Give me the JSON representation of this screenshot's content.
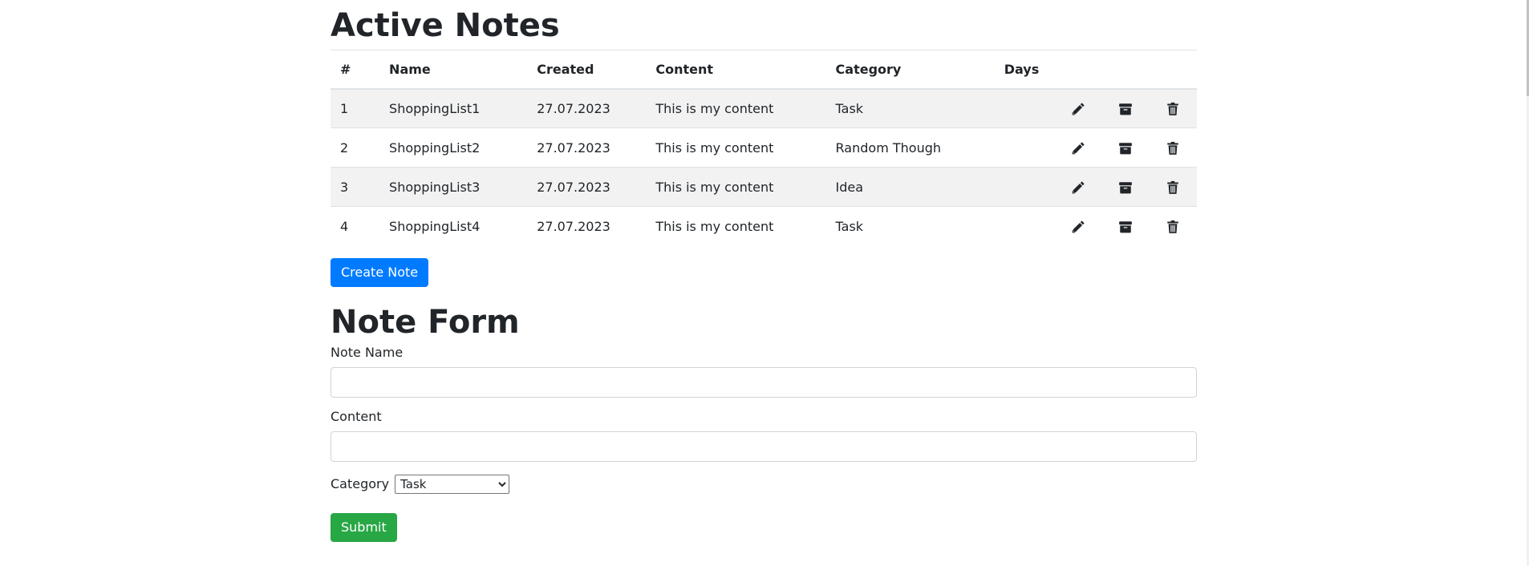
{
  "active_notes": {
    "title": "Active Notes",
    "columns": [
      "#",
      "Name",
      "Created",
      "Content",
      "Category",
      "Days"
    ],
    "rows": [
      {
        "num": "1",
        "name": "ShoppingList1",
        "created": "27.07.2023",
        "content": "This is my content",
        "category": "Task",
        "days": ""
      },
      {
        "num": "2",
        "name": "ShoppingList2",
        "created": "27.07.2023",
        "content": "This is my content",
        "category": "Random Though",
        "days": ""
      },
      {
        "num": "3",
        "name": "ShoppingList3",
        "created": "27.07.2023",
        "content": "This is my content",
        "category": "Idea",
        "days": ""
      },
      {
        "num": "4",
        "name": "ShoppingList4",
        "created": "27.07.2023",
        "content": "This is my content",
        "category": "Task",
        "days": ""
      }
    ],
    "row_actions": [
      "pencil-icon",
      "archive-icon",
      "trash-icon"
    ],
    "create_label": "Create Note"
  },
  "note_form": {
    "title": "Note Form",
    "name_label": "Note Name",
    "name_value": "",
    "content_label": "Content",
    "content_value": "",
    "category_label": "Category",
    "category_selected": "Task",
    "submit_label": "Submit"
  },
  "colors": {
    "primary": "#007bff",
    "success": "#28a745",
    "stripe": "#f2f2f2",
    "text": "#212529"
  }
}
